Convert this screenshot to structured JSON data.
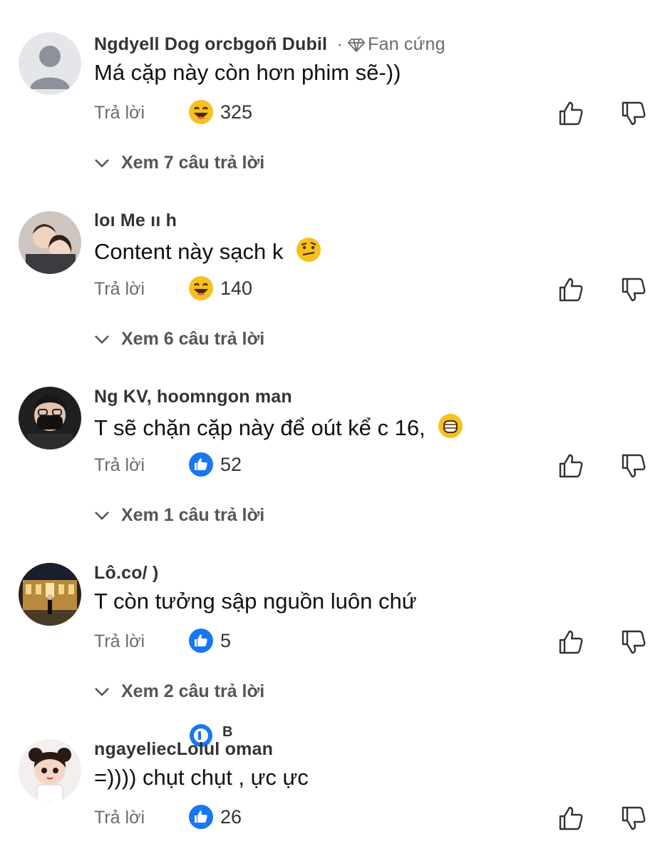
{
  "comments": [
    {
      "author": "Ngdyell Dog  orcbgoñ Dubil",
      "badge": "Fan cứng",
      "text": "Má cặp này còn hơn phim sẽ-))",
      "reply_label": "Trả lời",
      "reaction": "laugh",
      "reaction_count": "325",
      "view_replies": "Xem 7 câu trả lời"
    },
    {
      "author": "loı Me          ıı h",
      "text": "Content này sạch k",
      "text_emoji": "raised-eyebrow-emoji",
      "reply_label": "Trả lời",
      "reaction": "laugh",
      "reaction_count": "140",
      "view_replies": "Xem 6 câu trả lời"
    },
    {
      "author": "Ng KV,  hoomngon man",
      "text": "T sẽ chặn cặp này để oút kể c 16,",
      "text_emoji": "grimace-emoji",
      "reply_label": "Trả lời",
      "reaction": "like",
      "reaction_count": "52",
      "view_replies": "Xem 1 câu trả lời"
    },
    {
      "author": "Lô.co/            )",
      "text": "T còn tưởng sập nguồn luôn chứ",
      "reply_label": "Trả lời",
      "reaction": "like",
      "reaction_count": "5",
      "view_replies": "Xem 2 câu trả lời"
    },
    {
      "author": "ngayeliecLolul oman",
      "text": "=)))) chụt chụt , ực ực",
      "reply_label": "Trả lời",
      "reaction": "like",
      "reaction_count": "26"
    }
  ],
  "floating_artifact": "B",
  "colors": {
    "like_blue": "#1877f2",
    "laugh_yellow": "#f7c01e",
    "muted": "#6b6b6b"
  }
}
